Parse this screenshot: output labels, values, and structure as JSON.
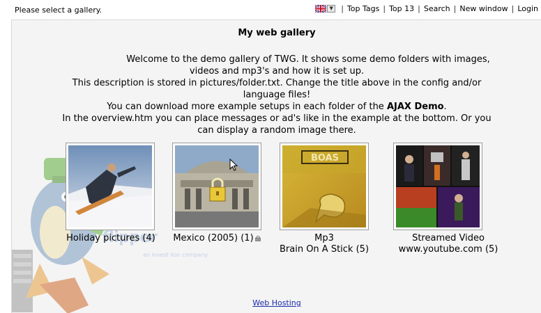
{
  "header": {
    "status_text": "Please select a gallery.",
    "language": {
      "icon": "uk-flag-icon",
      "dropdown_icon": "chevron-down-icon"
    },
    "nav": [
      {
        "label": "Top Tags"
      },
      {
        "label": "Top 13"
      },
      {
        "label": "Search"
      },
      {
        "label": "New window"
      },
      {
        "label": "Login"
      }
    ]
  },
  "main": {
    "title": "My web gallery",
    "description": {
      "line1": "Welcome to the demo gallery of TWG. It shows some demo folders with images,",
      "line2": "videos and mp3's and how it is set up.",
      "line3": "This description is stored in pictures/folder.txt. Change the title above in the config and/or",
      "line4": "language files!",
      "line5_prefix": "You can download more example setups in each folder of the ",
      "line5_bold": "AJAX Demo",
      "line5_suffix": ".",
      "line6": "In the overview.htm you can place messages or ad's like in the example at the bottom. Or you",
      "line7": "can display a random image there."
    },
    "galleries": [
      {
        "caption1": "Holiday pictures (4)",
        "caption2": "",
        "locked": false,
        "icon": "snowboard-photo"
      },
      {
        "caption1": "Mexico (2005) (1)",
        "caption2": "",
        "locked": true,
        "icon": "building-photo"
      },
      {
        "caption1": "Mp3",
        "caption2": "Brain On A Stick (5)",
        "locked": false,
        "icon": "album-cover"
      },
      {
        "caption1": "Streamed Video",
        "caption2": "www.youtube.com (5)",
        "locked": false,
        "icon": "video-collage"
      }
    ],
    "watermark": {
      "text": "flipper",
      "sub": "an invest lion company"
    },
    "footer_link": "Web Hosting"
  },
  "colors": {
    "panel_bg": "#f4f4f4",
    "link": "#1a2aa8",
    "border": "#9a9a9a"
  }
}
